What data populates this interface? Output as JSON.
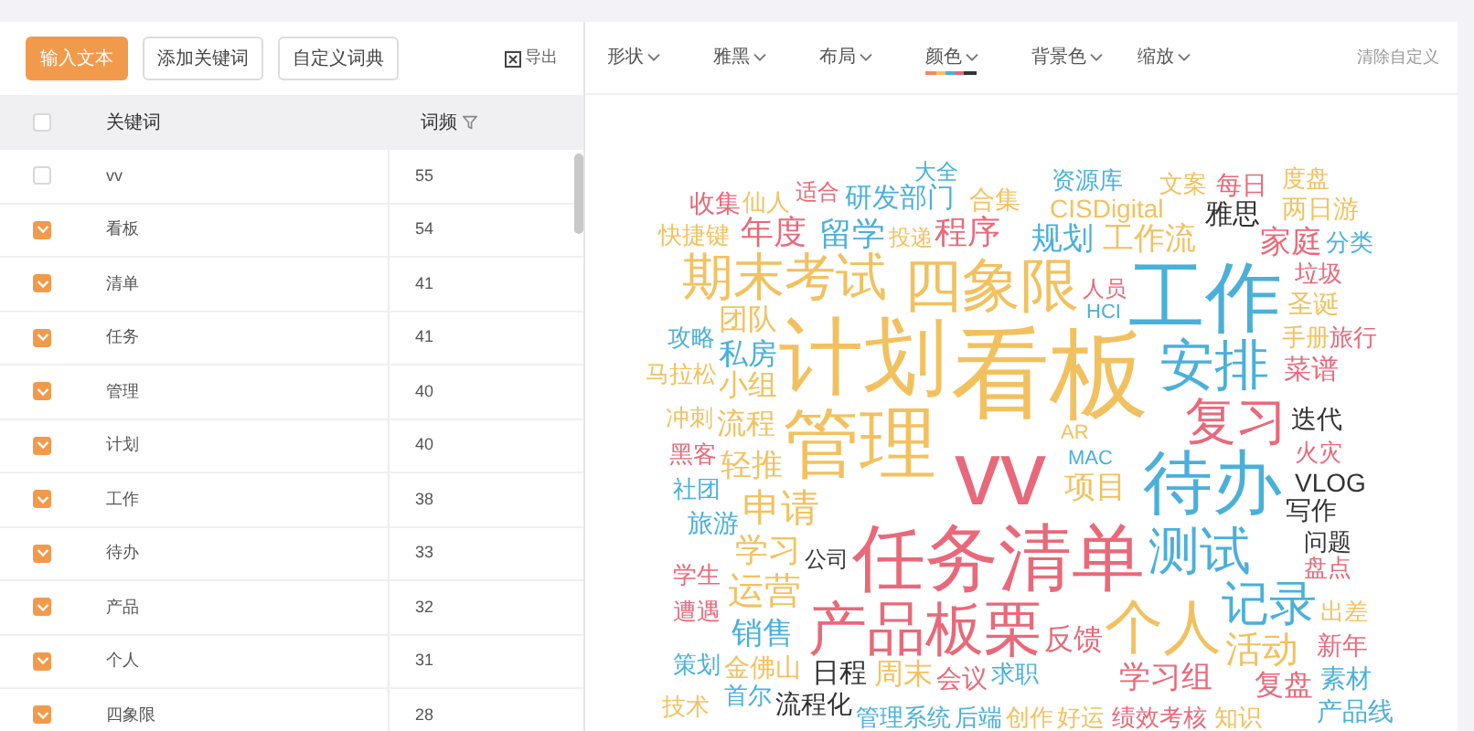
{
  "toolbar_left": {
    "buttons": [
      {
        "label": "输入文本",
        "kind": "primary"
      },
      {
        "label": "添加关键词",
        "kind": "default"
      },
      {
        "label": "自定义词典",
        "kind": "default"
      }
    ],
    "export": "导出"
  },
  "toolbar_right": {
    "menus": [
      {
        "label": "形状",
        "kind": "plain"
      },
      {
        "label": "雅黑",
        "kind": "plain"
      },
      {
        "label": "布局",
        "kind": "plain"
      },
      {
        "label": "颜色",
        "kind": "palette"
      },
      {
        "label": "背景色",
        "kind": "plain"
      },
      {
        "label": "缩放",
        "kind": "plain"
      }
    ],
    "clear": "清除自定义"
  },
  "table": {
    "header_checked": false,
    "columns": [
      "关键词",
      "词频"
    ],
    "rows": [
      {
        "keyword": "vv",
        "count": "55",
        "checked": false
      },
      {
        "keyword": "看板",
        "count": "54",
        "checked": true
      },
      {
        "keyword": "清单",
        "count": "41",
        "checked": true
      },
      {
        "keyword": "任务",
        "count": "41",
        "checked": true
      },
      {
        "keyword": "管理",
        "count": "40",
        "checked": true
      },
      {
        "keyword": "计划",
        "count": "40",
        "checked": true
      },
      {
        "keyword": "工作",
        "count": "38",
        "checked": true
      },
      {
        "keyword": "待办",
        "count": "33",
        "checked": true
      },
      {
        "keyword": "产品",
        "count": "32",
        "checked": true
      },
      {
        "keyword": "个人",
        "count": "31",
        "checked": true
      },
      {
        "keyword": "四象限",
        "count": "28",
        "checked": true
      }
    ]
  },
  "word_cloud": [
    {
      "text": "大全",
      "color": "#4ab0d9"
    },
    {
      "text": "资源库",
      "color": "#4ab0d9"
    },
    {
      "text": "文案",
      "color": "#f2c15f"
    },
    {
      "text": "每日",
      "color": "#e8697a"
    },
    {
      "text": "度盘",
      "color": "#f2c15f"
    },
    {
      "text": "收集",
      "color": "#e8697a"
    },
    {
      "text": "仙人",
      "color": "#f2c15f"
    },
    {
      "text": "适合",
      "color": "#e8697a"
    },
    {
      "text": "研发部门",
      "color": "#4ab0d9"
    },
    {
      "text": "合集",
      "color": "#f2c15f"
    },
    {
      "text": "CISDigital",
      "color": "#f2c15f"
    },
    {
      "text": "雅思",
      "color": "#333333"
    },
    {
      "text": "两日游",
      "color": "#f2c15f"
    },
    {
      "text": "快捷键",
      "color": "#f2c15f"
    },
    {
      "text": "年度",
      "color": "#e8697a"
    },
    {
      "text": "留学",
      "color": "#4ab0d9"
    },
    {
      "text": "投递",
      "color": "#f2c15f"
    },
    {
      "text": "程序",
      "color": "#e8697a"
    },
    {
      "text": "规划",
      "color": "#4ab0d9"
    },
    {
      "text": "工作流",
      "color": "#f2c15f"
    },
    {
      "text": "家庭",
      "color": "#e8697a"
    },
    {
      "text": "分类",
      "color": "#4ab0d9"
    },
    {
      "text": "期末考试",
      "color": "#f2c15f"
    },
    {
      "text": "四象限",
      "color": "#f2c15f"
    },
    {
      "text": "人员",
      "color": "#e8697a"
    },
    {
      "text": "HCI",
      "color": "#4ab0d9"
    },
    {
      "text": "工作",
      "color": "#4ab0d9"
    },
    {
      "text": "垃圾",
      "color": "#e8697a"
    },
    {
      "text": "圣诞",
      "color": "#f2c15f"
    },
    {
      "text": "攻略",
      "color": "#4ab0d9"
    },
    {
      "text": "团队",
      "color": "#f2c15f"
    },
    {
      "text": "计划",
      "color": "#f2c15f"
    },
    {
      "text": "看板",
      "color": "#f2c15f"
    },
    {
      "text": "手册",
      "color": "#f2c15f"
    },
    {
      "text": "旅行",
      "color": "#e8697a"
    },
    {
      "text": "马拉松",
      "color": "#f2c15f"
    },
    {
      "text": "私房",
      "color": "#4ab0d9"
    },
    {
      "text": "小组",
      "color": "#f2c15f"
    },
    {
      "text": "安排",
      "color": "#4ab0d9"
    },
    {
      "text": "菜谱",
      "color": "#e8697a"
    },
    {
      "text": "冲刺",
      "color": "#f2c15f"
    },
    {
      "text": "流程",
      "color": "#f2c15f"
    },
    {
      "text": "管理",
      "color": "#f2c15f"
    },
    {
      "text": "复习",
      "color": "#e8697a"
    },
    {
      "text": "迭代",
      "color": "#333333"
    },
    {
      "text": "黑客",
      "color": "#e8697a"
    },
    {
      "text": "轻推",
      "color": "#f2c15f"
    },
    {
      "text": "vv",
      "color": "#e8697a"
    },
    {
      "text": "AR",
      "color": "#f2c15f"
    },
    {
      "text": "MAC",
      "color": "#4ab0d9"
    },
    {
      "text": "待办",
      "color": "#4ab0d9"
    },
    {
      "text": "火灾",
      "color": "#e8697a"
    },
    {
      "text": "社团",
      "color": "#4ab0d9"
    },
    {
      "text": "旅游",
      "color": "#4ab0d9"
    },
    {
      "text": "申请",
      "color": "#f2c15f"
    },
    {
      "text": "项目",
      "color": "#f2c15f"
    },
    {
      "text": "VLOG",
      "color": "#333333"
    },
    {
      "text": "写作",
      "color": "#333333"
    },
    {
      "text": "学生",
      "color": "#e8697a"
    },
    {
      "text": "学习",
      "color": "#f2c15f"
    },
    {
      "text": "公司",
      "color": "#333333"
    },
    {
      "text": "运营",
      "color": "#f2c15f"
    },
    {
      "text": "任务清单",
      "color": "#e8697a"
    },
    {
      "text": "测试",
      "color": "#4ab0d9"
    },
    {
      "text": "问题",
      "color": "#333333"
    },
    {
      "text": "盘点",
      "color": "#e8697a"
    },
    {
      "text": "遭遇",
      "color": "#e8697a"
    },
    {
      "text": "产品板栗",
      "color": "#e8697a"
    },
    {
      "text": "个人",
      "color": "#f2c15f"
    },
    {
      "text": "记录",
      "color": "#4ab0d9"
    },
    {
      "text": "出差",
      "color": "#f2c15f"
    },
    {
      "text": "销售",
      "color": "#4ab0d9"
    },
    {
      "text": "反馈",
      "color": "#e8697a"
    },
    {
      "text": "活动",
      "color": "#f2c15f"
    },
    {
      "text": "新年",
      "color": "#e8697a"
    },
    {
      "text": "策划",
      "color": "#4ab0d9"
    },
    {
      "text": "金佛山",
      "color": "#f2c15f"
    },
    {
      "text": "日程",
      "color": "#333333"
    },
    {
      "text": "周末",
      "color": "#f2c15f"
    },
    {
      "text": "会议",
      "color": "#e8697a"
    },
    {
      "text": "求职",
      "color": "#4ab0d9"
    },
    {
      "text": "学习组",
      "color": "#e8697a"
    },
    {
      "text": "复盘",
      "color": "#e8697a"
    },
    {
      "text": "素材",
      "color": "#4ab0d9"
    },
    {
      "text": "技术",
      "color": "#f2c15f"
    },
    {
      "text": "首尔",
      "color": "#4ab0d9"
    },
    {
      "text": "流程化",
      "color": "#333333"
    },
    {
      "text": "管理系统",
      "color": "#4ab0d9"
    },
    {
      "text": "后端",
      "color": "#4ab0d9"
    },
    {
      "text": "创作",
      "color": "#f2c15f"
    },
    {
      "text": "好运",
      "color": "#f2c15f"
    },
    {
      "text": "绩效考核",
      "color": "#e8697a"
    },
    {
      "text": "知识",
      "color": "#f2c15f"
    },
    {
      "text": "产品线",
      "color": "#4ab0d9"
    }
  ]
}
